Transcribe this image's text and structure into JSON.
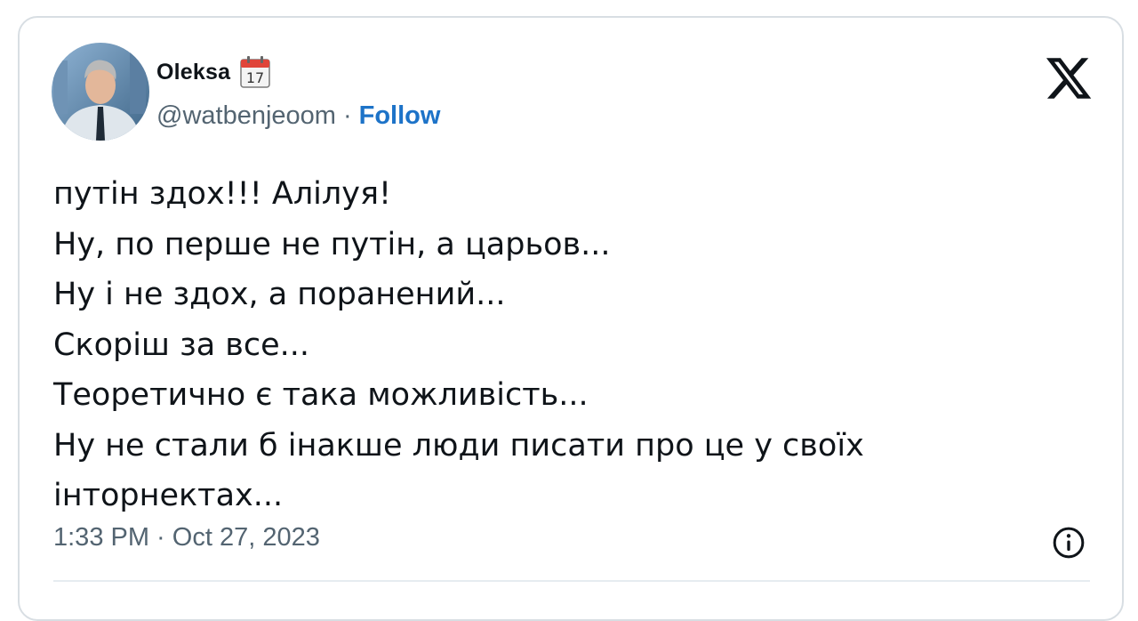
{
  "author": {
    "display_name": "Oleksa",
    "handle": "@watbenjeoom",
    "separator": "·",
    "follow_label": "Follow",
    "badge_icon": "calendar-icon",
    "badge_day": "17"
  },
  "tweet": {
    "lines": [
      "путін здох!!! Алілуя!",
      "Ну, по перше не путін, а царьов...",
      "Ну і не здох, а поранений...",
      "Скоріш за все...",
      "Теоретично є така можливість...",
      "Ну не стали б інакше люди писати про це у своїх",
      "інторнектах..."
    ],
    "timestamp": "1:33 PM · Oct 27, 2023"
  },
  "icons": {
    "logo": "x-logo-icon",
    "info": "info-icon"
  },
  "colors": {
    "follow": "#1d73c8",
    "text": "#0f1419",
    "muted": "#536471",
    "border": "#d8dee3"
  }
}
